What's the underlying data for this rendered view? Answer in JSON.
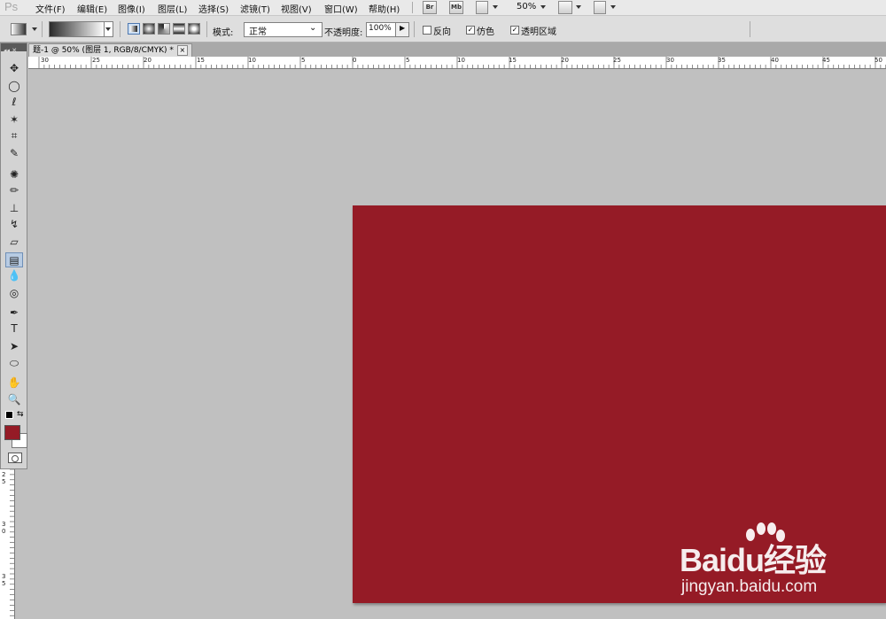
{
  "app": {
    "logo": "Ps"
  },
  "menu": [
    {
      "label": "文件(F)"
    },
    {
      "label": "编辑(E)"
    },
    {
      "label": "图像(I)"
    },
    {
      "label": "图层(L)"
    },
    {
      "label": "选择(S)"
    },
    {
      "label": "滤镜(T)"
    },
    {
      "label": "视图(V)"
    },
    {
      "label": "窗口(W)"
    },
    {
      "label": "帮助(H)"
    }
  ],
  "appbar": {
    "bridge": "Br",
    "minibridge": "Mb",
    "zoom": "50%"
  },
  "options": {
    "mode_label": "模式:",
    "mode_value": "正常",
    "opacity_label": "不透明度:",
    "opacity_value": "100%",
    "reverse_label": "反向",
    "dither_label": "仿色",
    "transparency_label": "透明区域",
    "reverse_checked": false,
    "dither_checked": true,
    "transparency_checked": true
  },
  "document": {
    "tab_title": "题-1 @ 50% (图层 1, RGB/8/CMYK) *",
    "close": "×"
  },
  "ruler": {
    "h_labels": [
      "30",
      "25",
      "20",
      "15",
      "10",
      "5",
      "0",
      "5",
      "10",
      "15",
      "20",
      "25",
      "30",
      "35",
      "40",
      "45",
      "50"
    ],
    "v_labels": [
      "2",
      "5",
      "3",
      "0",
      "3",
      "5"
    ]
  },
  "colors": {
    "foreground": "#951b26",
    "background": "#ffffff",
    "canvas": "#951b26",
    "workspace": "#c0c0c0"
  },
  "tools": [
    {
      "name": "move-tool-icon",
      "glyph": "✥"
    },
    {
      "name": "marquee-tool-icon",
      "glyph": "◯"
    },
    {
      "name": "lasso-tool-icon",
      "glyph": "ℓ"
    },
    {
      "name": "quick-select-tool-icon",
      "glyph": "✶"
    },
    {
      "name": "crop-tool-icon",
      "glyph": "⌗"
    },
    {
      "name": "eyedropper-tool-icon",
      "glyph": "✎"
    },
    {
      "name": "healing-brush-tool-icon",
      "glyph": "✺"
    },
    {
      "name": "brush-tool-icon",
      "glyph": "✏"
    },
    {
      "name": "clone-stamp-tool-icon",
      "glyph": "⊥"
    },
    {
      "name": "history-brush-tool-icon",
      "glyph": "↯"
    },
    {
      "name": "eraser-tool-icon",
      "glyph": "▱"
    },
    {
      "name": "gradient-tool-icon",
      "glyph": "▤"
    },
    {
      "name": "blur-tool-icon",
      "glyph": "💧"
    },
    {
      "name": "dodge-tool-icon",
      "glyph": "◎"
    },
    {
      "name": "pen-tool-icon",
      "glyph": "✒"
    },
    {
      "name": "type-tool-icon",
      "glyph": "T"
    },
    {
      "name": "path-selection-tool-icon",
      "glyph": "➤"
    },
    {
      "name": "shape-tool-icon",
      "glyph": "⬭"
    },
    {
      "name": "hand-tool-icon",
      "glyph": "✋"
    },
    {
      "name": "zoom-tool-icon",
      "glyph": "🔍"
    }
  ],
  "watermark": {
    "brand": "Baidu经验",
    "url": "jingyan.baidu.com"
  }
}
